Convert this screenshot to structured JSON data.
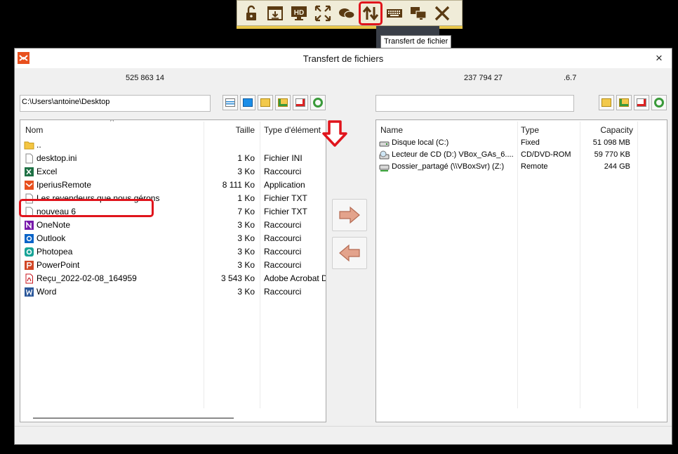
{
  "toolbar": {
    "buttons": [
      {
        "icon": "unlock-icon"
      },
      {
        "icon": "download-window-icon"
      },
      {
        "icon": "hd-monitor-icon",
        "label": "HD"
      },
      {
        "icon": "fullscreen-icon"
      },
      {
        "icon": "chat-icon"
      },
      {
        "icon": "file-transfer-icon"
      },
      {
        "icon": "keyboard-icon"
      },
      {
        "icon": "multi-monitor-icon"
      },
      {
        "icon": "close-icon"
      }
    ],
    "tooltip": "Transfert de fichier"
  },
  "window": {
    "title": "Transfert de fichiers",
    "close_symbol": "×"
  },
  "left": {
    "counter": "525 863 14",
    "path": "C:\\Users\\antoine\\Desktop",
    "columns": {
      "name": "Nom",
      "size": "Taille",
      "type": "Type d'élément"
    },
    "sort_indicator": "^",
    "files": [
      {
        "name": "..",
        "size": "",
        "type": "",
        "icon": "folder-icon"
      },
      {
        "name": "desktop.ini",
        "size": "1 Ko",
        "type": "Fichier INI",
        "icon": "file-icon"
      },
      {
        "name": "Excel",
        "size": "3 Ko",
        "type": "Raccourci",
        "icon": "excel-icon"
      },
      {
        "name": "IperiusRemote",
        "size": "8 111 Ko",
        "type": "Application",
        "icon": "iperius-icon"
      },
      {
        "name": "Les revendeurs que nous gérons",
        "size": "1 Ko",
        "type": "Fichier TXT",
        "icon": "file-icon"
      },
      {
        "name": "nouveau 6",
        "size": "7 Ko",
        "type": "Fichier TXT",
        "icon": "file-icon"
      },
      {
        "name": "OneNote",
        "size": "3 Ko",
        "type": "Raccourci",
        "icon": "onenote-icon"
      },
      {
        "name": "Outlook",
        "size": "3 Ko",
        "type": "Raccourci",
        "icon": "outlook-icon"
      },
      {
        "name": "Photopea",
        "size": "3 Ko",
        "type": "Raccourci",
        "icon": "photopea-icon"
      },
      {
        "name": "PowerPoint",
        "size": "3 Ko",
        "type": "Raccourci",
        "icon": "powerpoint-icon"
      },
      {
        "name": "Reçu_2022-02-08_164959",
        "size": "3 543 Ko",
        "type": "Adobe Acrobat D",
        "icon": "pdf-icon"
      },
      {
        "name": "Word",
        "size": "3 Ko",
        "type": "Raccourci",
        "icon": "word-icon"
      }
    ]
  },
  "right": {
    "counter": "237 794 27",
    "counter_suffix": ".6.7",
    "path": "",
    "columns": {
      "name": "Name",
      "type": "Type",
      "capacity": "Capacity"
    },
    "drives": [
      {
        "name": "Disque local (C:)",
        "type": "Fixed",
        "capacity": "51 098 MB",
        "icon": "hard-drive-icon"
      },
      {
        "name": "Lecteur de CD (D:) VBox_GAs_6....",
        "type": "CD/DVD-ROM",
        "capacity": "59 770 KB",
        "icon": "cd-drive-icon"
      },
      {
        "name": "Dossier_partagé (\\\\VBoxSvr) (Z:)",
        "type": "Remote",
        "capacity": "244 GB",
        "icon": "network-drive-icon"
      }
    ]
  },
  "colors": {
    "highlight": "#e0141c",
    "toolbar_bg": "#f0ecd8",
    "toolbar_icon": "#5a3a12"
  }
}
